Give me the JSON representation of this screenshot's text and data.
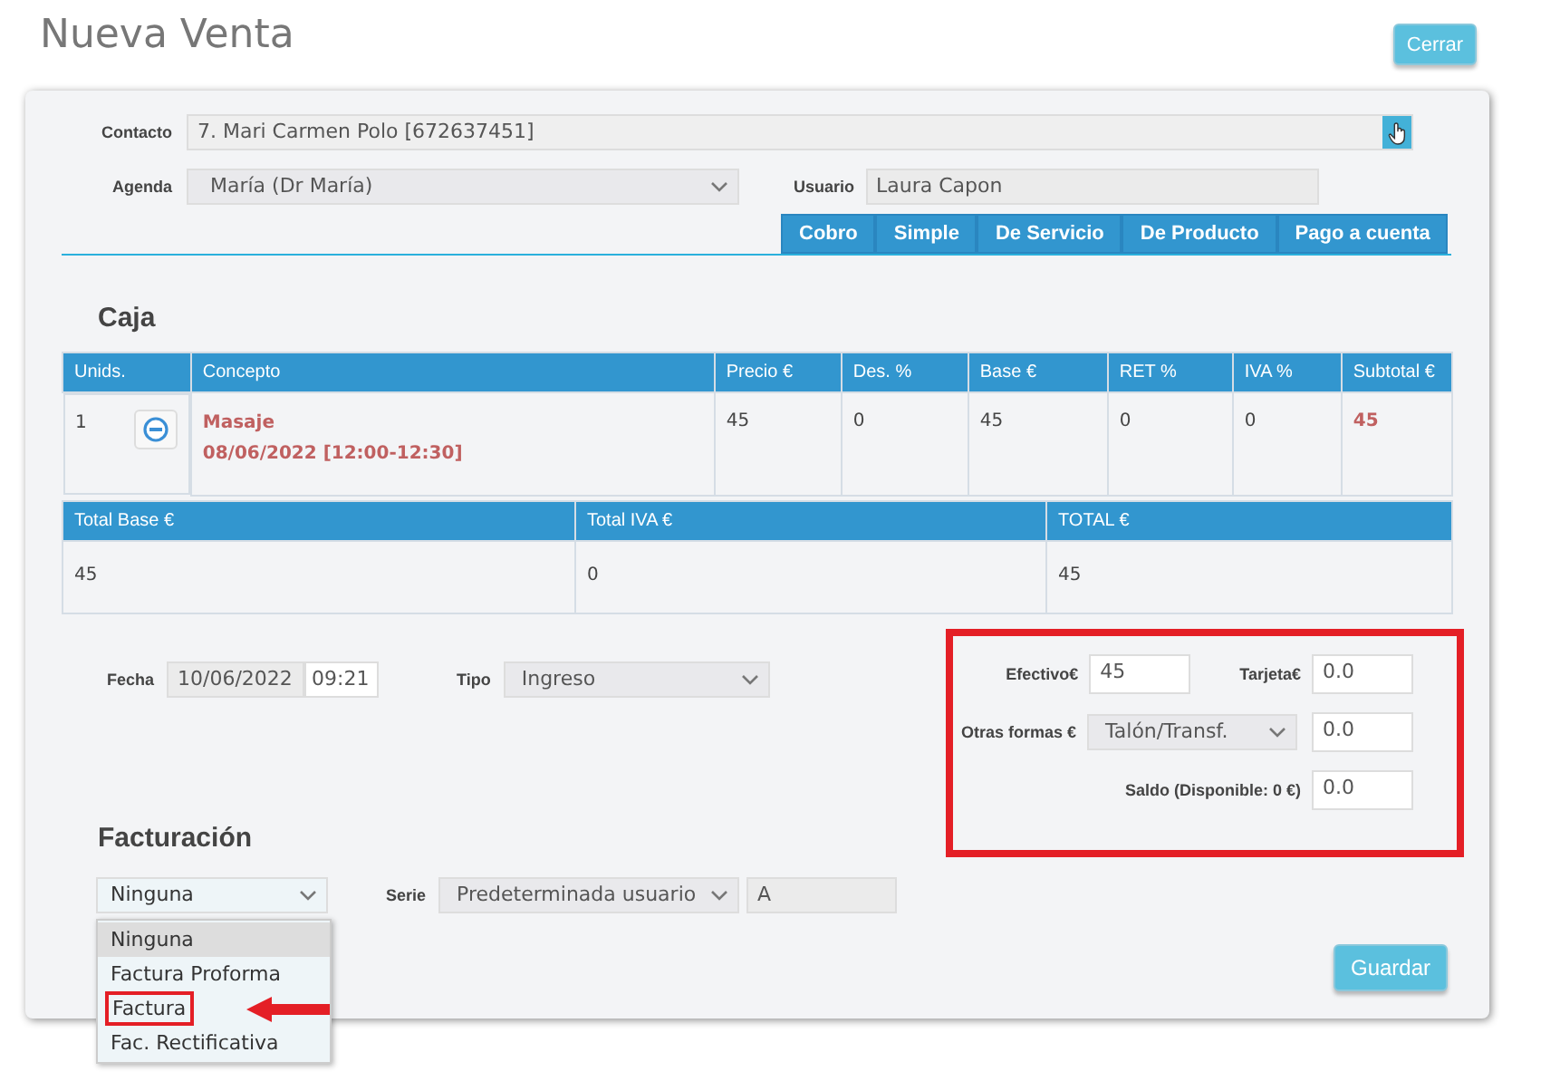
{
  "title": "Nueva Venta",
  "close_button": "Cerrar",
  "contact": {
    "label": "Contacto",
    "value": "7. Mari Carmen Polo [672637451]"
  },
  "agenda": {
    "label": "Agenda",
    "value": "María (Dr María)"
  },
  "user": {
    "label": "Usuario",
    "value": "Laura Capon"
  },
  "tabs": [
    {
      "label": "Cobro",
      "selected": false
    },
    {
      "label": "Simple",
      "selected": false
    },
    {
      "label": "De Servicio",
      "selected": false
    },
    {
      "label": "De Producto",
      "selected": false
    },
    {
      "label": "Pago a cuenta",
      "selected": false
    }
  ],
  "caja": {
    "heading": "Caja",
    "columns": [
      "Unids.",
      "Concepto",
      "Precio €",
      "Des. %",
      "Base €",
      "RET %",
      "IVA %",
      "Subtotal €"
    ],
    "rows": [
      {
        "cells": [
          "1",
          "Masaje",
          "45",
          "0",
          "45",
          "0",
          "0",
          "45"
        ],
        "detail": "08/06/2022 [12:00-12:30]"
      }
    ],
    "totals": {
      "columns": [
        "Total Base €",
        "Total IVA €",
        "TOTAL €"
      ],
      "values": [
        "45",
        "0",
        "45"
      ]
    }
  },
  "fecha": {
    "label": "Fecha",
    "date": "10/06/2022",
    "time": "09:21"
  },
  "tipo": {
    "label": "Tipo",
    "value": "Ingreso"
  },
  "payment": {
    "highlighted": true,
    "cash": {
      "label": "Efectivo€",
      "value": "45"
    },
    "card": {
      "label": "Tarjeta€",
      "value": "0.0"
    },
    "other": {
      "label": "Otras formas €",
      "method": "Talón/Transf.",
      "value": "0.0"
    },
    "balance": {
      "label": "Saldo (Disponible: 0 €)",
      "value": "0.0"
    }
  },
  "billing": {
    "heading": "Facturación",
    "value": "Ninguna",
    "expanded": true,
    "options": [
      {
        "label": "Ninguna",
        "selected": true,
        "annotated": false
      },
      {
        "label": "Factura Proforma",
        "selected": false,
        "annotated": false
      },
      {
        "label": "Factura",
        "selected": false,
        "annotated": true
      },
      {
        "label": "Fac. Rectificativa",
        "selected": false,
        "annotated": false
      }
    ],
    "serie": {
      "label": "Serie",
      "value": "Predeterminada usuario",
      "code": "A"
    }
  },
  "save_button": "Guardar"
}
